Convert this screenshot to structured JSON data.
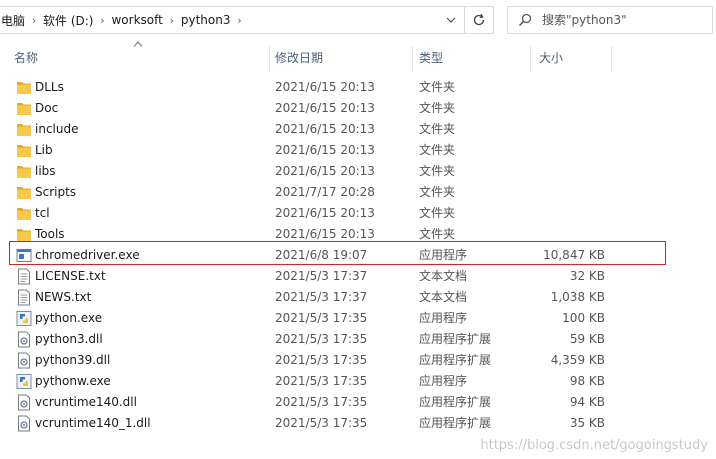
{
  "address": {
    "crumbs": [
      "电脑",
      "软件 (D:)",
      "worksoft",
      "python3"
    ],
    "refresh_icon": "refresh-icon",
    "dropdown_icon": "chevron-down-icon"
  },
  "search": {
    "placeholder": "搜索\"python3\"",
    "icon": "search-icon"
  },
  "columns": {
    "name": "名称",
    "date": "修改日期",
    "type": "类型",
    "size": "大小"
  },
  "files": [
    {
      "name": "DLLs",
      "date": "2021/6/15 20:13",
      "type": "文件夹",
      "size": "",
      "icon": "folder-icon"
    },
    {
      "name": "Doc",
      "date": "2021/6/15 20:13",
      "type": "文件夹",
      "size": "",
      "icon": "folder-icon"
    },
    {
      "name": "include",
      "date": "2021/6/15 20:13",
      "type": "文件夹",
      "size": "",
      "icon": "folder-icon"
    },
    {
      "name": "Lib",
      "date": "2021/6/15 20:13",
      "type": "文件夹",
      "size": "",
      "icon": "folder-icon"
    },
    {
      "name": "libs",
      "date": "2021/6/15 20:13",
      "type": "文件夹",
      "size": "",
      "icon": "folder-icon"
    },
    {
      "name": "Scripts",
      "date": "2021/7/17 20:28",
      "type": "文件夹",
      "size": "",
      "icon": "folder-icon"
    },
    {
      "name": "tcl",
      "date": "2021/6/15 20:13",
      "type": "文件夹",
      "size": "",
      "icon": "folder-icon"
    },
    {
      "name": "Tools",
      "date": "2021/6/15 20:13",
      "type": "文件夹",
      "size": "",
      "icon": "folder-icon"
    },
    {
      "name": "chromedriver.exe",
      "date": "2021/6/8 19:07",
      "type": "应用程序",
      "size": "10,847 KB",
      "icon": "exe-icon"
    },
    {
      "name": "LICENSE.txt",
      "date": "2021/5/3 17:37",
      "type": "文本文档",
      "size": "32 KB",
      "icon": "text-file-icon"
    },
    {
      "name": "NEWS.txt",
      "date": "2021/5/3 17:37",
      "type": "文本文档",
      "size": "1,038 KB",
      "icon": "text-file-icon"
    },
    {
      "name": "python.exe",
      "date": "2021/5/3 17:35",
      "type": "应用程序",
      "size": "100 KB",
      "icon": "python-icon"
    },
    {
      "name": "python3.dll",
      "date": "2021/5/3 17:35",
      "type": "应用程序扩展",
      "size": "59 KB",
      "icon": "dll-icon"
    },
    {
      "name": "python39.dll",
      "date": "2021/5/3 17:35",
      "type": "应用程序扩展",
      "size": "4,359 KB",
      "icon": "dll-icon"
    },
    {
      "name": "pythonw.exe",
      "date": "2021/5/3 17:35",
      "type": "应用程序",
      "size": "98 KB",
      "icon": "python-icon"
    },
    {
      "name": "vcruntime140.dll",
      "date": "2021/5/3 17:35",
      "type": "应用程序扩展",
      "size": "94 KB",
      "icon": "dll-icon"
    },
    {
      "name": "vcruntime140_1.dll",
      "date": "2021/5/3 17:35",
      "type": "应用程序扩展",
      "size": "35 KB",
      "icon": "dll-icon"
    }
  ],
  "watermark": "https://blog.csdn.net/gogoingstudy",
  "colors": {
    "folder": "#f5c342",
    "highlight_border": "#d0242c",
    "header_text": "#4c607a"
  }
}
